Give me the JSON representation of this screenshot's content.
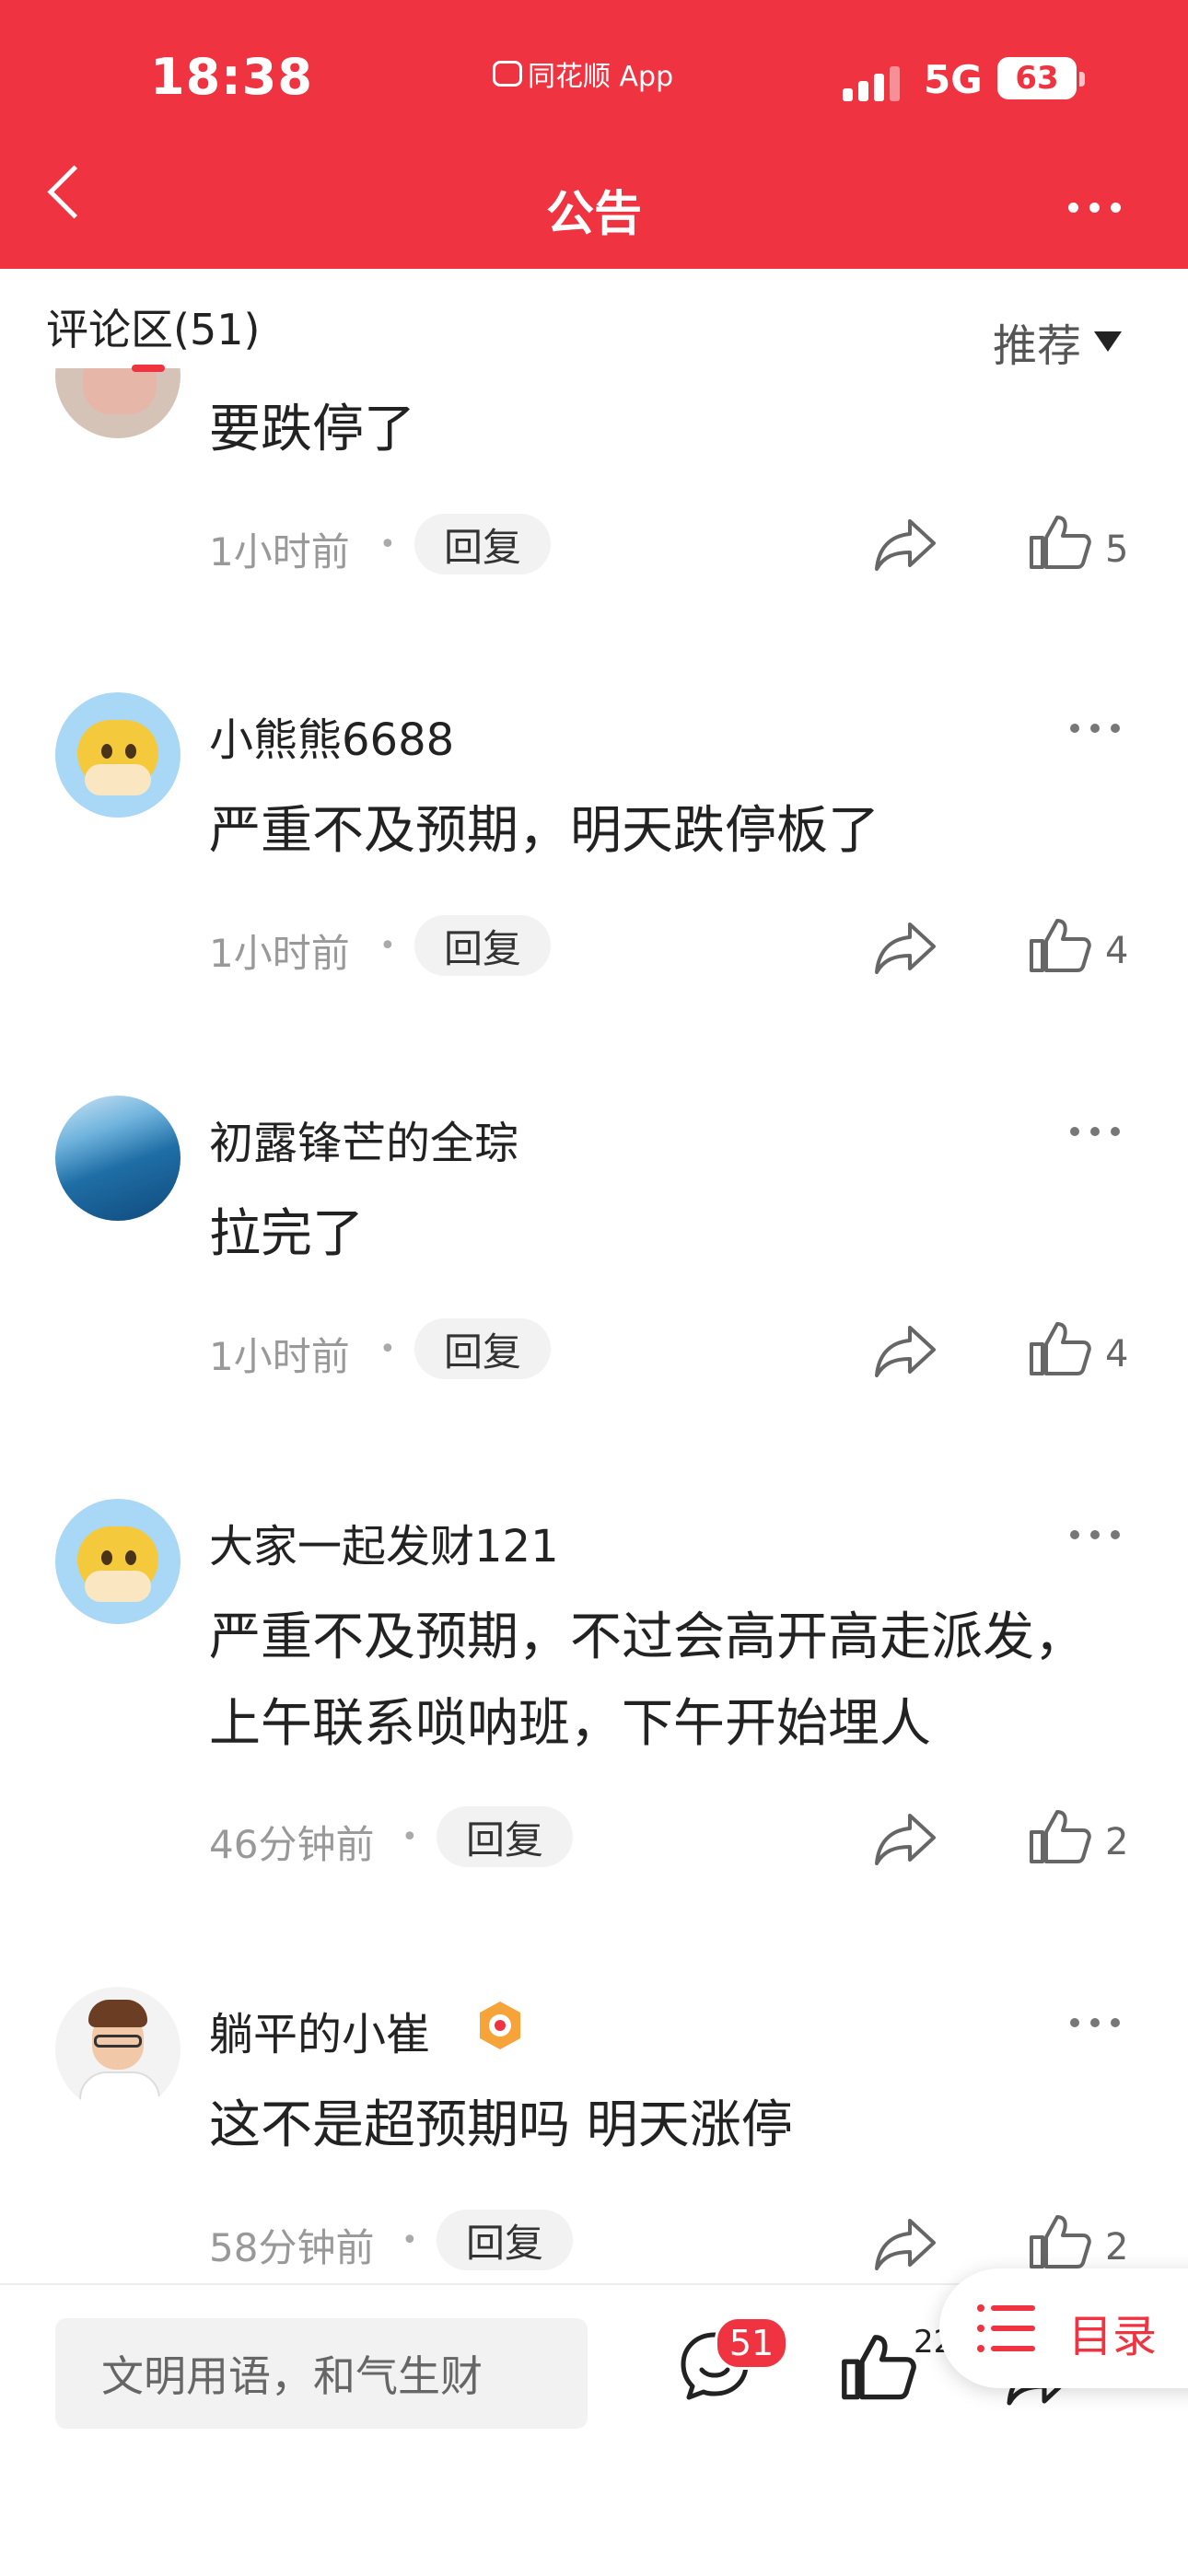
{
  "status_bar": {
    "time": "18:38",
    "app_label": "同花顺 App",
    "network": "5G",
    "battery": "63"
  },
  "nav": {
    "title": "公告"
  },
  "comments_header": {
    "title": "评论区(51)",
    "sort_label": "推荐"
  },
  "comments": [
    {
      "username": "",
      "text": "要跌停了",
      "time": "1小时前",
      "reply_label": "回复",
      "likes": "5"
    },
    {
      "username": "小熊熊6688",
      "text": "严重不及预期，明天跌停板了",
      "time": "1小时前",
      "reply_label": "回复",
      "likes": "4"
    },
    {
      "username": "初露锋芒的全琮",
      "text": "拉完了",
      "time": "1小时前",
      "reply_label": "回复",
      "likes": "4"
    },
    {
      "username": "大家一起发财121",
      "text": "严重不及预期，不过会高开高走派发，上午联系唢呐班，下午开始埋人",
      "time": "46分钟前",
      "reply_label": "回复",
      "likes": "2"
    },
    {
      "username": "躺平的小崔",
      "text": "这不是超预期吗 明天涨停",
      "time": "58分钟前",
      "reply_label": "回复",
      "likes": "2"
    }
  ],
  "bottom_bar": {
    "input_placeholder": "文明用语，和气生财",
    "comment_count": "51",
    "like_count": "22"
  },
  "toc_button": {
    "label": "目录"
  },
  "colors": {
    "brand_red": "#ef3340",
    "text_gray": "#999999"
  },
  "icons": [
    "back-icon",
    "more-icon",
    "share-icon",
    "thumbs-up-icon",
    "comment-icon",
    "list-icon",
    "caret-down-icon"
  ]
}
